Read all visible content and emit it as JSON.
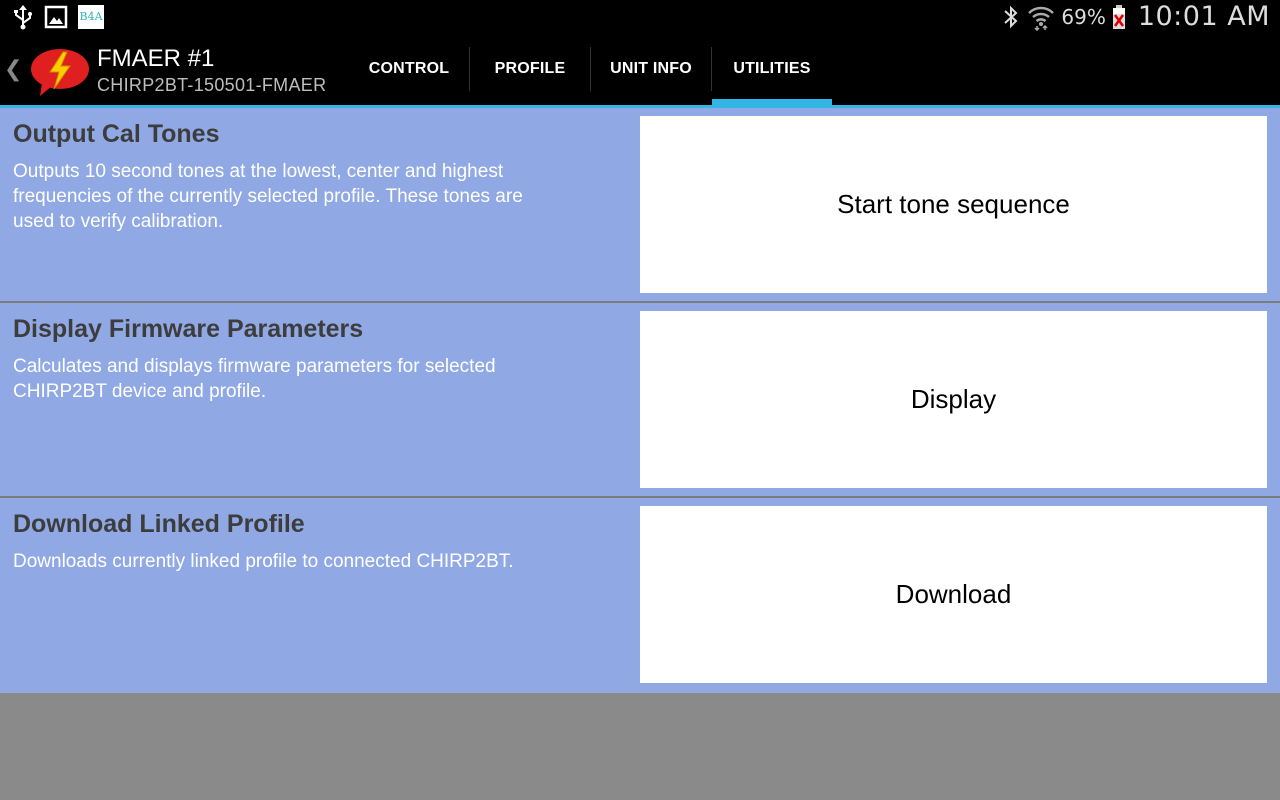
{
  "status_bar": {
    "left_icons": [
      "usb-icon",
      "gallery-icon",
      "b4a-app-icon"
    ],
    "b4a_label": "B4A",
    "battery_percent": "69%",
    "time": "10:01 AM"
  },
  "action_bar": {
    "title": "FMAER #1",
    "subtitle": "CHIRP2BT-150501-FMAER",
    "tabs": [
      {
        "label": "CONTROL",
        "selected": false
      },
      {
        "label": "PROFILE",
        "selected": false
      },
      {
        "label": "UNIT INFO",
        "selected": false
      },
      {
        "label": "UTILITIES",
        "selected": true
      }
    ],
    "accent_color": "#33b5e5",
    "logo_color": "#e02020"
  },
  "sections": [
    {
      "title": "Output Cal Tones",
      "description": "Outputs 10 second tones at the lowest, center and highest frequencies of the currently selected profile. These tones are used to verify calibration.",
      "button_label": "Start tone sequence"
    },
    {
      "title": "Display Firmware Parameters",
      "description": "Calculates and displays firmware parameters for selected CHIRP2BT device and profile.",
      "button_label": "Display"
    },
    {
      "title": "Download Linked Profile",
      "description": "Downloads currently linked profile to connected CHIRP2BT.",
      "button_label": "Download"
    }
  ],
  "colors": {
    "content_background": "#90a8e4",
    "empty_background": "#8a8a8a"
  }
}
